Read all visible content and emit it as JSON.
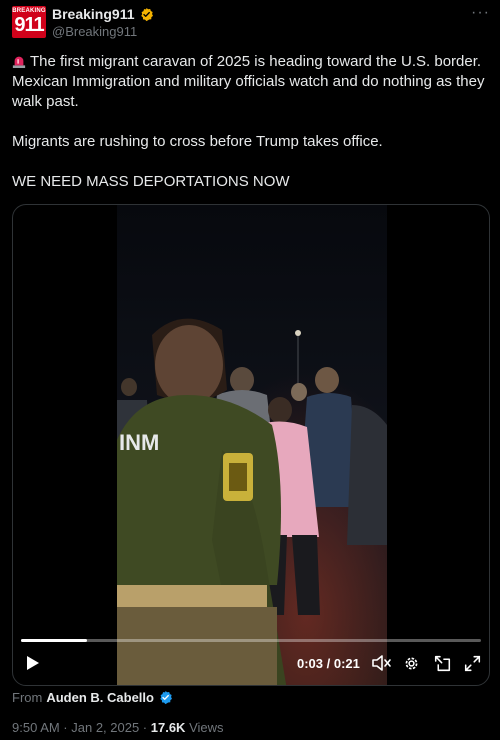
{
  "account": {
    "avatar_small": "BREAKING",
    "avatar_big": "911",
    "name": "Breaking911",
    "handle": "@Breaking911",
    "verified_color": "#f5b300",
    "more_label": "···"
  },
  "post": {
    "line1": "The first migrant caravan of 2025 is heading toward the U.S. border. Mexican Immigration and military officials watch and do nothing as they walk past.",
    "line2": "Migrants are rushing to cross before Trump takes office.",
    "line3": "WE NEED MASS DEPORTATIONS NOW",
    "emoji": "siren-icon"
  },
  "video": {
    "uniform_text": "INM",
    "time_display": "0:03 / 0:21",
    "progress": 0.143,
    "icons": [
      "play-icon",
      "mute-icon",
      "settings-icon",
      "popout-icon",
      "fullscreen-icon"
    ]
  },
  "attribution": {
    "prefix": "From",
    "source": "Auden B. Cabello",
    "verified_color": "#1d9bf0"
  },
  "meta": {
    "timestamp": "9:50 AM · Jan 2, 2025 · ",
    "views_count": "17.6K",
    "views_label": " Views"
  },
  "colors": {
    "background": "#000000",
    "text": "#e7e9ea",
    "muted": "#71767b",
    "border": "#2f3336",
    "brand_red": "#d0021b"
  }
}
